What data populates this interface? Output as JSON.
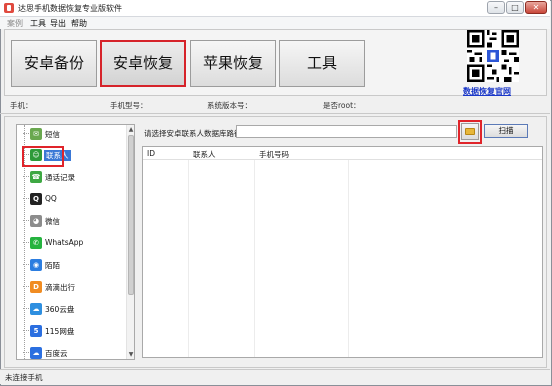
{
  "window": {
    "title": "达思手机数据恢复专业版软件",
    "controls": {
      "minimize": "–",
      "maximize": "□",
      "close": "✕"
    }
  },
  "menubar": {
    "items": [
      {
        "label": "案例",
        "disabled": true
      },
      {
        "label": "工具",
        "disabled": false
      },
      {
        "label": "导出",
        "disabled": false
      },
      {
        "label": "帮助",
        "disabled": false
      }
    ]
  },
  "toolbar": {
    "buttons": [
      {
        "label": "安卓备份",
        "active": false
      },
      {
        "label": "安卓恢复",
        "active": true
      },
      {
        "label": "苹果恢复",
        "active": false
      },
      {
        "label": "工具",
        "active": false
      }
    ],
    "qr_link": "数据恢复官网"
  },
  "device_info": {
    "phone_label": "手机：",
    "model_label": "手机型号：",
    "os_label": "系统版本号：",
    "root_label": "是否root："
  },
  "sidebar": {
    "items": [
      {
        "label": "短信",
        "icon": "sms-icon",
        "color": "#6aa84f"
      },
      {
        "label": "联系人",
        "icon": "contacts-icon",
        "color": "#2e9a3a",
        "selected": true
      },
      {
        "label": "通话记录",
        "icon": "call-log-icon",
        "color": "#3ea843"
      },
      {
        "label": "QQ",
        "icon": "qq-icon",
        "color": "#222222"
      },
      {
        "label": "微信",
        "icon": "wechat-icon",
        "color": "#8c8c8c"
      },
      {
        "label": "WhatsApp",
        "icon": "whatsapp-icon",
        "color": "#25b33f"
      },
      {
        "label": "陌陌",
        "icon": "momo-icon",
        "color": "#2b7de0"
      },
      {
        "label": "滴滴出行",
        "icon": "didi-icon",
        "color": "#f08c22"
      },
      {
        "label": "360云盘",
        "icon": "360-cloud-icon",
        "color": "#2e8fe0"
      },
      {
        "label": "115网盘",
        "icon": "115-disk-icon",
        "color": "#2b6fe0"
      },
      {
        "label": "百度云",
        "icon": "baidu-cloud-icon",
        "color": "#2b6fe0"
      }
    ]
  },
  "main": {
    "path_label": "请选择安卓联系人数据库路径：",
    "path_value": "",
    "scan_label": "扫描",
    "columns": [
      "ID",
      "联系人",
      "手机号码"
    ]
  },
  "status": {
    "text": "未连接手机"
  },
  "colors": {
    "highlight": "#e0242a",
    "selection": "#3a78d6",
    "link": "#1a37c8"
  }
}
